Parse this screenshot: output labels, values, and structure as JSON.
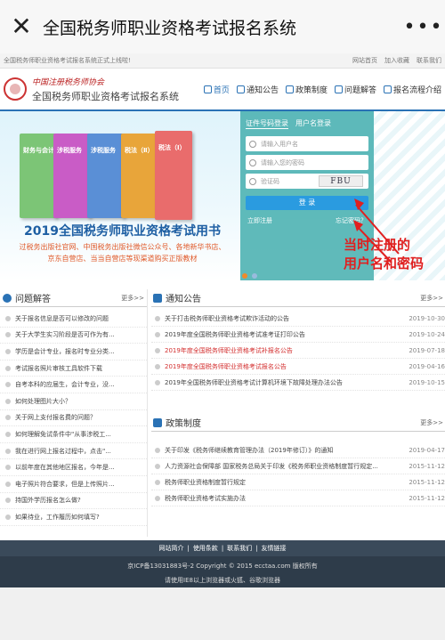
{
  "appbar": {
    "title": "全国税务师职业资格考试报名系统"
  },
  "topbar": {
    "notice": "全国税务师职业资格考试报名系统正式上线啦!",
    "links": [
      "网站首页",
      "加入收藏",
      "联系我们"
    ]
  },
  "header": {
    "brand_line1": "中国注册税务师协会",
    "brand_line2": "全国税务师职业资格考试报名系统",
    "nav": [
      "首页",
      "通知公告",
      "政策制度",
      "问题解答",
      "报名流程介绍"
    ]
  },
  "banner": {
    "books": [
      "财务与会计",
      "涉税服务",
      "涉税服务",
      "税法（Ⅱ）",
      "税法（Ⅰ）"
    ],
    "title": "2019全国税务师职业资格考试用书",
    "sub1": "过税务出版社官网、中国税务出版社微信公众号、各地新华书店、",
    "sub2": "京东自营店、当当自营店等现渠道购买正版教材"
  },
  "login": {
    "tab1": "证件号码登录",
    "tab2": "用户名登录",
    "user_ph": "请输入用户名",
    "pass_ph": "请输入您的密码",
    "captcha_ph": "验证码",
    "captcha": "FBU",
    "button": "登 录",
    "register": "立即注册",
    "forgot": "忘记密码？"
  },
  "annotation": {
    "line1": "当时注册的",
    "line2": "用户名和密码"
  },
  "faq": {
    "title": "问题解答",
    "more": "更多>>",
    "items": [
      "关于报名信息是否可以修改的问题",
      "关于大学生实习阶段是否可作为有...",
      "学历是会计专业，报名时专业分类...",
      "考试报名照片审核工具软件下载",
      "自考本科的应届生，会计专业，没...",
      "如何处理图片大小？",
      "关于网上支付报名费的问题？",
      "如何理解免试条件中\"从事涉税工...",
      "我在进行网上报名过程中，点击\"...",
      "以前年度在其他地区报名，今年是...",
      "电子照片符合要求，但是上传照片...",
      "持国外学历报名怎么做?",
      "如果待业，工作履历如何填写?"
    ]
  },
  "notice": {
    "title": "通知公告",
    "more": "更多>>",
    "items": [
      {
        "text": "关于打击税务师职业资格考试欺诈活动的公告",
        "date": "2019-10-30",
        "red": false
      },
      {
        "text": "2019年度全国税务师职业资格考试准考证打印公告",
        "date": "2019-10-24",
        "red": false
      },
      {
        "text": "2019年度全国税务师职业资格考试补报名公告",
        "date": "2019-07-18",
        "red": true
      },
      {
        "text": "2019年度全国税务师职业资格考试报名公告",
        "date": "2019-04-16",
        "red": true
      },
      {
        "text": "2019年全国税务师职业资格考试计算机环境下故障处理办法公告",
        "date": "2019-10-15",
        "red": false
      }
    ]
  },
  "policy": {
    "title": "政策制度",
    "more": "更多>>",
    "items": [
      {
        "text": "关于印发《税务师继续教育管理办法（2019年修订）》的通知",
        "date": "2019-04-17"
      },
      {
        "text": "人力资源社会保障部 国家税务总局关于印发《税务师职业资格制度暂行规定...",
        "date": "2015-11-12"
      },
      {
        "text": "税务师职业资格制度暂行规定",
        "date": "2015-11-12"
      },
      {
        "text": "税务师职业资格考试实施办法",
        "date": "2015-11-12"
      }
    ]
  },
  "footer": {
    "links": [
      "网站简介",
      "|",
      "使用条款",
      "|",
      "联系我们",
      "|",
      "友情链接"
    ],
    "line1": "京ICP备13031883号-2 Copyright © 2015 ecctaa.com 版权所有",
    "line2": "请使用IE8以上浏览器或火狐、谷歌浏览器"
  },
  "colors": {
    "accent": "#2a72b5",
    "annotation": "#e02020",
    "login_panel": "#4ab0b0"
  }
}
